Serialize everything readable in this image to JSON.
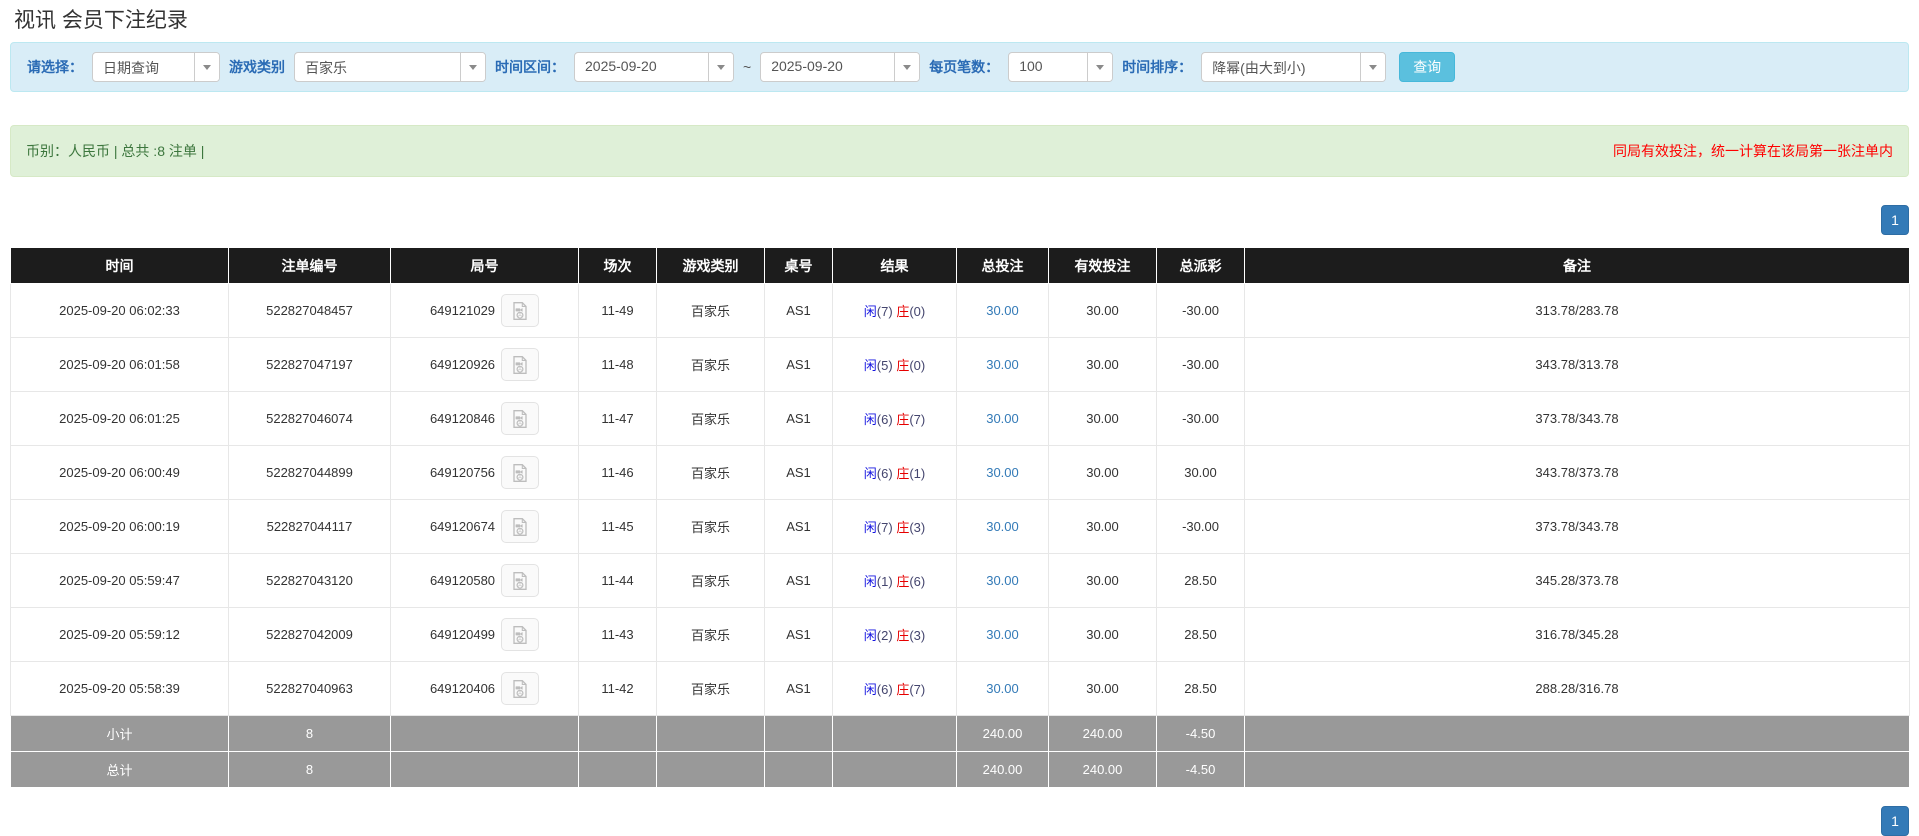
{
  "page": {
    "title": "视讯 会员下注纪录"
  },
  "filters": {
    "select_label": "请选择：",
    "select_value": "日期查询",
    "game_category_label": "游戏类别",
    "game_category_value": "百家乐",
    "time_range_label": "时间区间：",
    "date_from": "2025-09-20",
    "tilde": "~",
    "date_to": "2025-09-20",
    "page_size_label": "每页笔数：",
    "page_size_value": "100",
    "sort_label": "时间排序：",
    "sort_value": "降幂(由大到小)",
    "search_button": "查询"
  },
  "icons": {
    "select_caret": "chevron-down",
    "round_replay": "video-file"
  },
  "colors": {
    "filter_bg": "#d9edf7",
    "alert_bg": "#dff0d8",
    "alert_text": "#3c763d",
    "note_red": "#ff0000",
    "header_bg": "#1c1c1c",
    "totals_bg": "#999999",
    "link_blue": "#337ab7",
    "player_blue": "#1414e0",
    "banker_red": "#e60000",
    "search_btn": "#5bc0de"
  },
  "summary": {
    "left_text": "币别：人民币 | 总共 :8 注单 |",
    "right_text": "同局有效投注，统一计算在该局第一张注单内"
  },
  "pagination": {
    "page": "1"
  },
  "table": {
    "headers": [
      "时间",
      "注单编号",
      "局号",
      "场次",
      "游戏类别",
      "桌号",
      "结果",
      "总投注",
      "有效投注",
      "总派彩",
      "备注"
    ],
    "rows": [
      {
        "time": "2025-09-20 06:02:33",
        "bet_id": "522827048457",
        "round_id": "649121029",
        "session": "11-49",
        "game": "百家乐",
        "table_no": "AS1",
        "result_p": "闲",
        "result_p_score": "(7)",
        "result_b": "庄",
        "result_b_score": "(0)",
        "total_bet": "30.00",
        "valid_bet": "30.00",
        "payout": "-30.00",
        "remark": "313.78/283.78"
      },
      {
        "time": "2025-09-20 06:01:58",
        "bet_id": "522827047197",
        "round_id": "649120926",
        "session": "11-48",
        "game": "百家乐",
        "table_no": "AS1",
        "result_p": "闲",
        "result_p_score": "(5)",
        "result_b": "庄",
        "result_b_score": "(0)",
        "total_bet": "30.00",
        "valid_bet": "30.00",
        "payout": "-30.00",
        "remark": "343.78/313.78"
      },
      {
        "time": "2025-09-20 06:01:25",
        "bet_id": "522827046074",
        "round_id": "649120846",
        "session": "11-47",
        "game": "百家乐",
        "table_no": "AS1",
        "result_p": "闲",
        "result_p_score": "(6)",
        "result_b": "庄",
        "result_b_score": "(7)",
        "total_bet": "30.00",
        "valid_bet": "30.00",
        "payout": "-30.00",
        "remark": "373.78/343.78"
      },
      {
        "time": "2025-09-20 06:00:49",
        "bet_id": "522827044899",
        "round_id": "649120756",
        "session": "11-46",
        "game": "百家乐",
        "table_no": "AS1",
        "result_p": "闲",
        "result_p_score": "(6)",
        "result_b": "庄",
        "result_b_score": "(1)",
        "total_bet": "30.00",
        "valid_bet": "30.00",
        "payout": "30.00",
        "remark": "343.78/373.78"
      },
      {
        "time": "2025-09-20 06:00:19",
        "bet_id": "522827044117",
        "round_id": "649120674",
        "session": "11-45",
        "game": "百家乐",
        "table_no": "AS1",
        "result_p": "闲",
        "result_p_score": "(7)",
        "result_b": "庄",
        "result_b_score": "(3)",
        "total_bet": "30.00",
        "valid_bet": "30.00",
        "payout": "-30.00",
        "remark": "373.78/343.78"
      },
      {
        "time": "2025-09-20 05:59:47",
        "bet_id": "522827043120",
        "round_id": "649120580",
        "session": "11-44",
        "game": "百家乐",
        "table_no": "AS1",
        "result_p": "闲",
        "result_p_score": "(1)",
        "result_b": "庄",
        "result_b_score": "(6)",
        "total_bet": "30.00",
        "valid_bet": "30.00",
        "payout": "28.50",
        "remark": "345.28/373.78"
      },
      {
        "time": "2025-09-20 05:59:12",
        "bet_id": "522827042009",
        "round_id": "649120499",
        "session": "11-43",
        "game": "百家乐",
        "table_no": "AS1",
        "result_p": "闲",
        "result_p_score": "(2)",
        "result_b": "庄",
        "result_b_score": "(3)",
        "total_bet": "30.00",
        "valid_bet": "30.00",
        "payout": "28.50",
        "remark": "316.78/345.28"
      },
      {
        "time": "2025-09-20 05:58:39",
        "bet_id": "522827040963",
        "round_id": "649120406",
        "session": "11-42",
        "game": "百家乐",
        "table_no": "AS1",
        "result_p": "闲",
        "result_p_score": "(6)",
        "result_b": "庄",
        "result_b_score": "(7)",
        "total_bet": "30.00",
        "valid_bet": "30.00",
        "payout": "28.50",
        "remark": "288.28/316.78"
      }
    ],
    "subtotal": {
      "label": "小计",
      "count": "8",
      "total_bet": "240.00",
      "valid_bet": "240.00",
      "payout": "-4.50"
    },
    "grand_total": {
      "label": "总计",
      "count": "8",
      "total_bet": "240.00",
      "valid_bet": "240.00",
      "payout": "-4.50"
    }
  }
}
